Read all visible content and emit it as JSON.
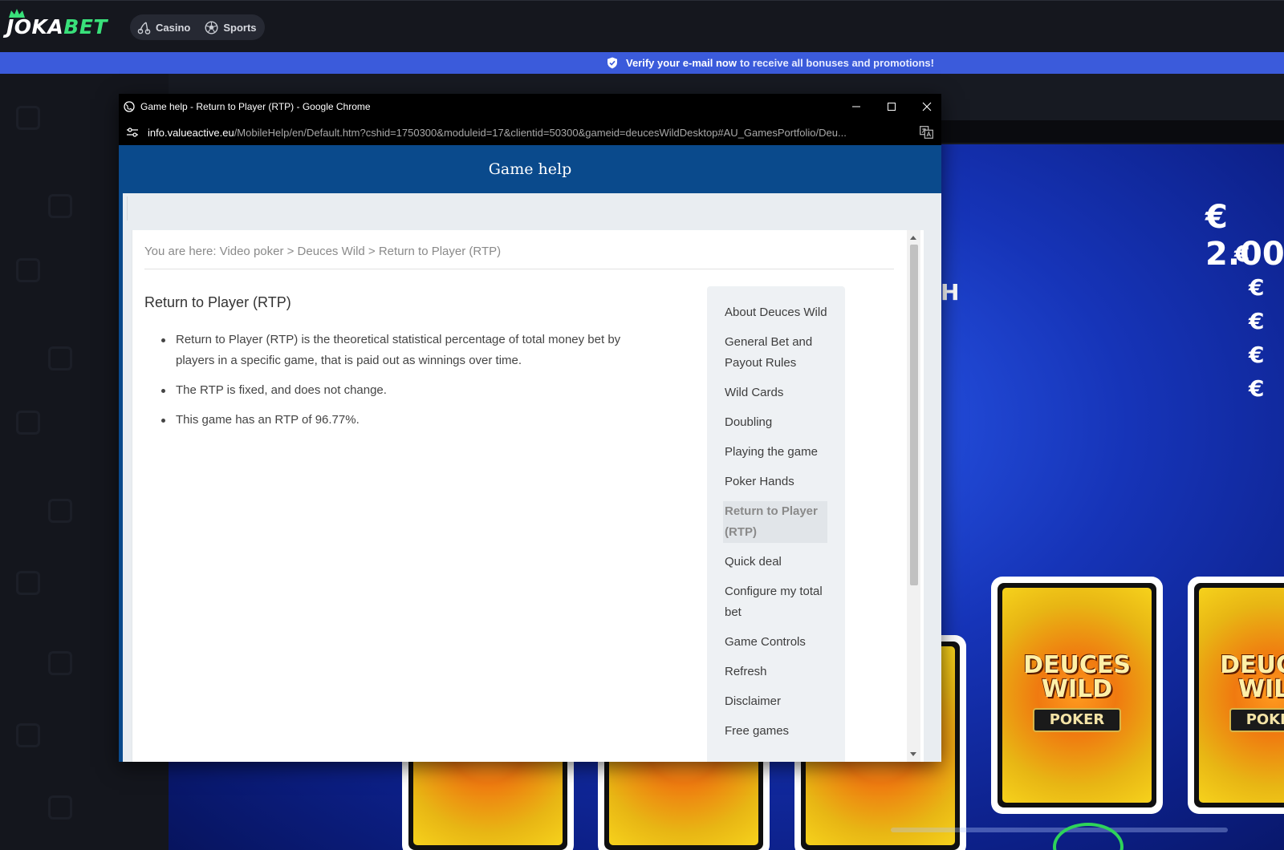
{
  "site": {
    "logo_main": "JOKA",
    "logo_accent": "BET",
    "nav": [
      {
        "label": "Casino",
        "icon": "cherries-icon"
      },
      {
        "label": "Sports",
        "icon": "soccer-ball-icon"
      }
    ],
    "verify_bold": "Verify your e-mail now",
    "verify_rest": "to receive all bonuses and promotions!"
  },
  "game": {
    "prize_main": "€ 2.00",
    "prize_rows": [
      "€ ",
      "€",
      "€",
      "€",
      "€"
    ],
    "side_letter": "H",
    "card_title": "DEUCES WILD",
    "card_sub": "POKER"
  },
  "popup": {
    "window_title": "Game help - Return to Player (RTP) - Google Chrome",
    "url_host": "info.valueactive.eu",
    "url_path": "/MobileHelp/en/Default.htm?cshid=1750300&moduleid=17&clientid=50300&gameid=deucesWildDesktop#AU_GamesPortfolio/Deu...",
    "header_title": "Game help",
    "breadcrumb": "You are here: Video poker > Deuces Wild > Return to Player (RTP)",
    "page_title": "Return to Player (RTP)",
    "bullets": [
      "Return to Player (RTP) is the theoretical statistical percentage of total money bet by players in a specific game, that is paid out as winnings over time.",
      "The RTP is fixed, and does not change.",
      "This game has an RTP of 96.77%."
    ],
    "toc": [
      "About Deuces Wild",
      "General Bet and Payout Rules",
      "Wild Cards",
      "Doubling",
      "Playing the game",
      "Poker Hands",
      "Return to Player (RTP)",
      "Quick deal",
      "Configure my total bet",
      "Game Controls",
      "Refresh",
      "Disclaimer",
      "Free games"
    ],
    "toc_active": "Return to Player (RTP)"
  },
  "colors": {
    "brand_green": "#39e07a",
    "verify_blue": "#3b5bdb",
    "help_header_blue": "#0a4a8c"
  }
}
